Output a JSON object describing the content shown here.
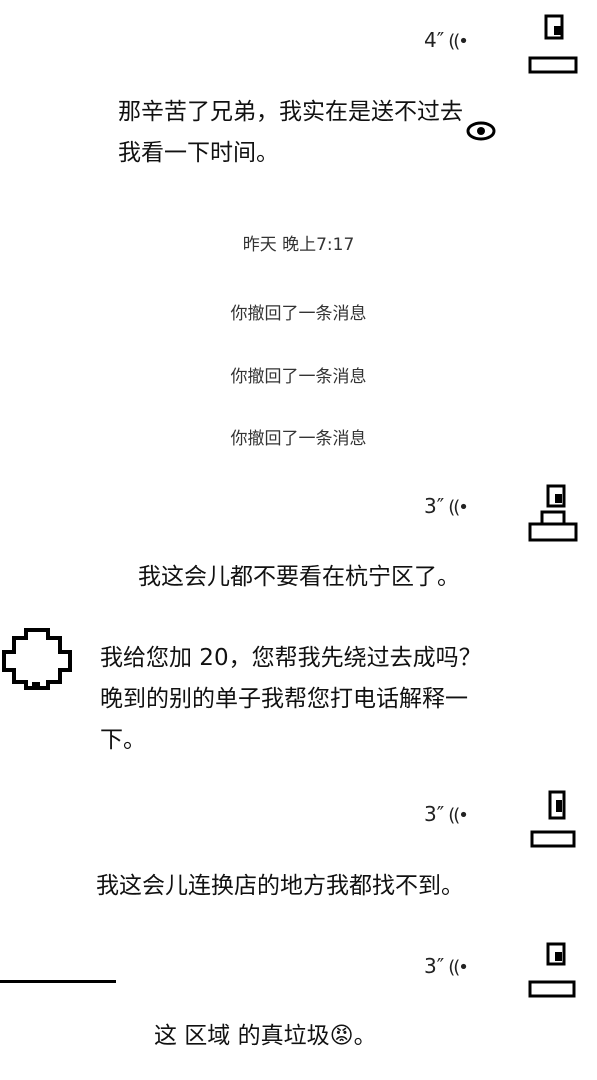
{
  "messages": [
    {
      "kind": "voice",
      "duration": "4″",
      "wave": "((•",
      "transcript": "那辛苦了兄弟，我实在是送不过去 我看一下时间。"
    },
    {
      "kind": "system",
      "text": "昨天 晚上7:17"
    },
    {
      "kind": "system",
      "text": "你撤回了一条消息"
    },
    {
      "kind": "system",
      "text": "你撤回了一条消息"
    },
    {
      "kind": "system",
      "text": "你撤回了一条消息"
    },
    {
      "kind": "voice",
      "duration": "3″",
      "wave": "((•",
      "transcript": "我这会儿都不要看在杭宁区了。"
    },
    {
      "kind": "received",
      "text": "我给您加 20，您帮我先绕过去成吗？晚到的别的单子我帮您打电话解释一下。"
    },
    {
      "kind": "voice",
      "duration": "3″",
      "wave": "((•",
      "transcript": "我这会儿连换店的地方我都找不到。"
    },
    {
      "kind": "voice",
      "duration": "3″",
      "wave": "((•",
      "transcript": "这  区域   的真垃圾😡。"
    }
  ],
  "icons": {
    "eye": "eye-icon",
    "voice_wave": "voice-wave-icon",
    "avatar": "avatar"
  },
  "colors": {
    "text": "#111111",
    "background": "#ffffff"
  }
}
